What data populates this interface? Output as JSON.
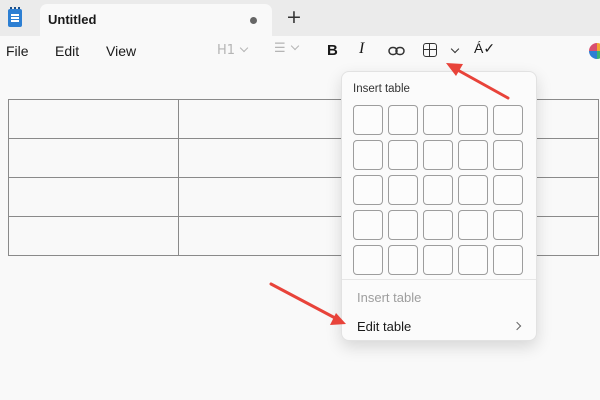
{
  "window": {
    "tab_title": "Untitled",
    "new_tab_label": "+",
    "app_icon": "notepad-icon"
  },
  "menu": {
    "items": [
      "File",
      "Edit",
      "View"
    ]
  },
  "toolbar": {
    "heading_label": "H1",
    "list_icon": "☰",
    "bold_label": "B",
    "italic_label": "I",
    "spellcheck_label": "Á✓",
    "icons": [
      "list-icon",
      "bold-icon",
      "italic-icon",
      "link-icon",
      "table-icon",
      "chevron-down-icon",
      "spellcheck-icon",
      "copilot-icon"
    ]
  },
  "document": {
    "table_rows": 4,
    "table_cols": 2
  },
  "table_menu": {
    "heading": "Insert table",
    "grid_rows": 5,
    "grid_cols": 5,
    "insert_label": "Insert table",
    "insert_enabled": false,
    "edit_label": "Edit table"
  },
  "colors": {
    "annotation": "#e8433a",
    "accent": "#2d7fd3"
  }
}
